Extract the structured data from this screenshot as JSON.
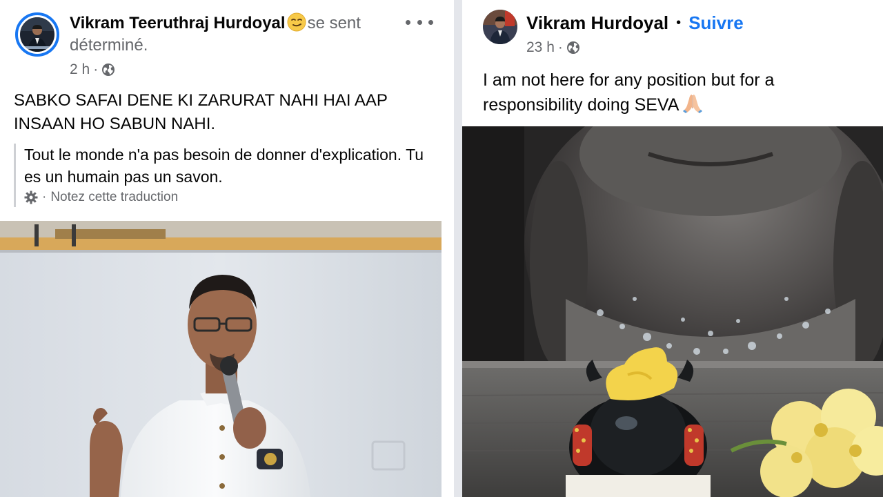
{
  "left_post": {
    "author": "Vikram Teeruthraj Hurdoyal",
    "feeling": "se sent déterminé.",
    "time": "2 h",
    "meta_separator": "·",
    "audience_icon": "globe-icon",
    "more_icon": "more-horizontal-icon",
    "feeling_icon": "determined-face-emoji",
    "text": "SABKO SAFAI DENE KI ZARURAT NAHI HAI AAP INSAAN HO SABUN NAHI.",
    "translation": {
      "text": "Tout le monde n'a pas besoin de donner d'explication. Tu es un humain pas un savon.",
      "separator": "·",
      "rate_label": "Notez cette traduction",
      "icon": "gear-icon"
    },
    "photo": "speaker-with-microphone-photo"
  },
  "right_post": {
    "author": "Vikram Hurdoyal",
    "bullet": "•",
    "follow_label": "Suivre",
    "time": "23 h",
    "meta_separator": "·",
    "audience_icon": "globe-icon",
    "text": "I am not here for any position but for a responsibility doing SEVA",
    "text_emoji": "folded-hands-emoji",
    "photo": "deity-statue-and-nandi-photo"
  },
  "colors": {
    "accent": "#1877f2",
    "secondary_text": "#65676b",
    "primary_text": "#050505",
    "divider": "#e4e6eb"
  }
}
